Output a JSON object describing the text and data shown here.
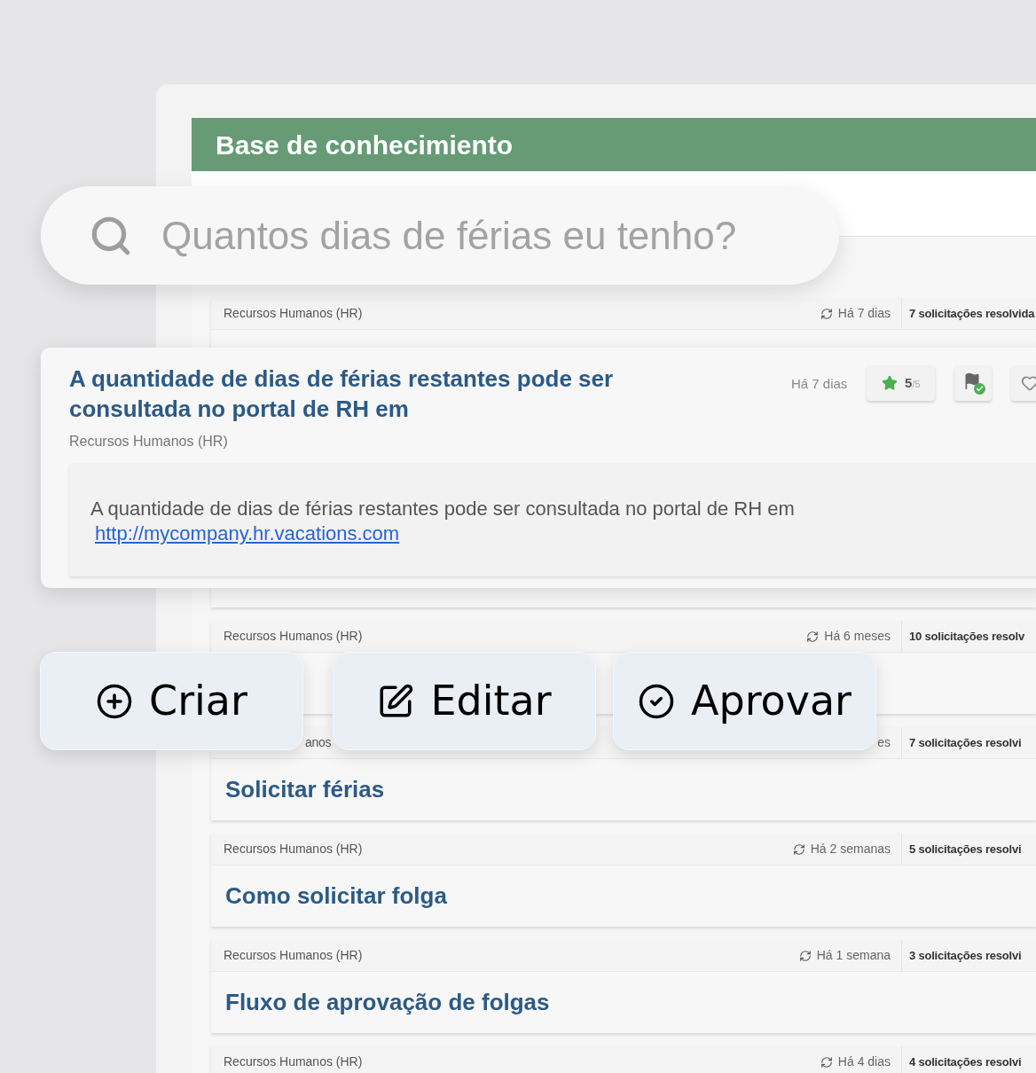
{
  "header": {
    "title": "Base de conhecimiento"
  },
  "search": {
    "placeholder": "Quantos dias de férias eu tenho?"
  },
  "articles": [
    {
      "category": "Recursos Humanos (HR)",
      "updated": "Há 7 dias",
      "resolved": "7 solicitações resolvida",
      "expanded": true
    },
    {
      "category": "Recursos Humanos (HR)",
      "updated": "Há 6 meses",
      "resolved": "10 solicitações resolv",
      "expanded": false
    },
    {
      "category": "anos",
      "updated": "es",
      "resolved": "7 solicitações resolvi",
      "expanded": false,
      "title": "Solicitar férias",
      "covered": true
    },
    {
      "category": "Recursos Humanos (HR)",
      "updated": "Há 2 semanas",
      "resolved": "5 solicitações resolvi",
      "expanded": false,
      "title": "Como solicitar folga"
    },
    {
      "category": "Recursos Humanos (HR)",
      "updated": "Há 1 semana",
      "resolved": "3 solicitações resolvi",
      "expanded": false,
      "title": "Fluxo de aprovação de folgas"
    },
    {
      "category": "Recursos Humanos (HR)",
      "updated": "Há 4 dias",
      "resolved": "4 solicitações resolvi",
      "expanded": false
    }
  ],
  "answer": {
    "title": "A quantidade de dias de férias restantes pode ser consultada no portal de RH em",
    "category": "Recursos Humanos (HR)",
    "updated": "Há 7 dias",
    "rating": "5",
    "rating_max": "/5",
    "verified": true,
    "text": "A quantidade de dias de férias restantes pode ser consultada no portal de RH em",
    "link": "http://mycompany.hr.vacations.com"
  },
  "actions": [
    {
      "kind": "create",
      "label": "Criar"
    },
    {
      "kind": "edit",
      "label": "Editar"
    },
    {
      "kind": "approve",
      "label": "Aprovar"
    }
  ]
}
